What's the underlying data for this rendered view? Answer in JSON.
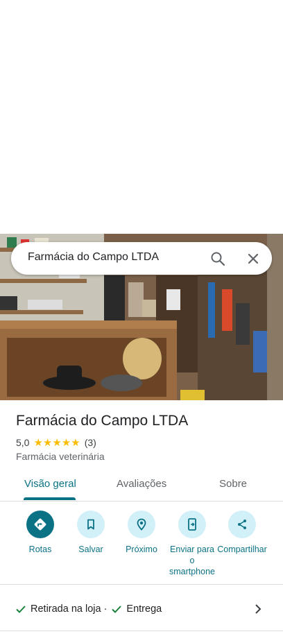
{
  "search": {
    "query": "Farmácia do Campo LTDA",
    "search_icon": "search-icon",
    "close_icon": "close-icon"
  },
  "place": {
    "name": "Farmácia do Campo LTDA",
    "rating": "5,0",
    "stars": "★★★★★",
    "review_count": "(3)",
    "category": "Farmácia veterinária"
  },
  "tabs": [
    {
      "label": "Visão geral",
      "active": true
    },
    {
      "label": "Avaliações",
      "active": false
    },
    {
      "label": "Sobre",
      "active": false
    }
  ],
  "actions": [
    {
      "label": "Rotas",
      "icon": "directions-icon"
    },
    {
      "label": "Salvar",
      "icon": "bookmark-icon"
    },
    {
      "label": "Próximo",
      "icon": "nearby-icon"
    },
    {
      "label": "Enviar para o smartphone",
      "icon": "send-to-phone-icon"
    },
    {
      "label": "Compartilhar",
      "icon": "share-icon"
    }
  ],
  "features": {
    "item1": "Retirada na loja ·",
    "item2": "Entrega"
  },
  "colors": {
    "accent": "#0b7285",
    "action_bg": "#d2f0f7",
    "star": "#fbbc04"
  }
}
